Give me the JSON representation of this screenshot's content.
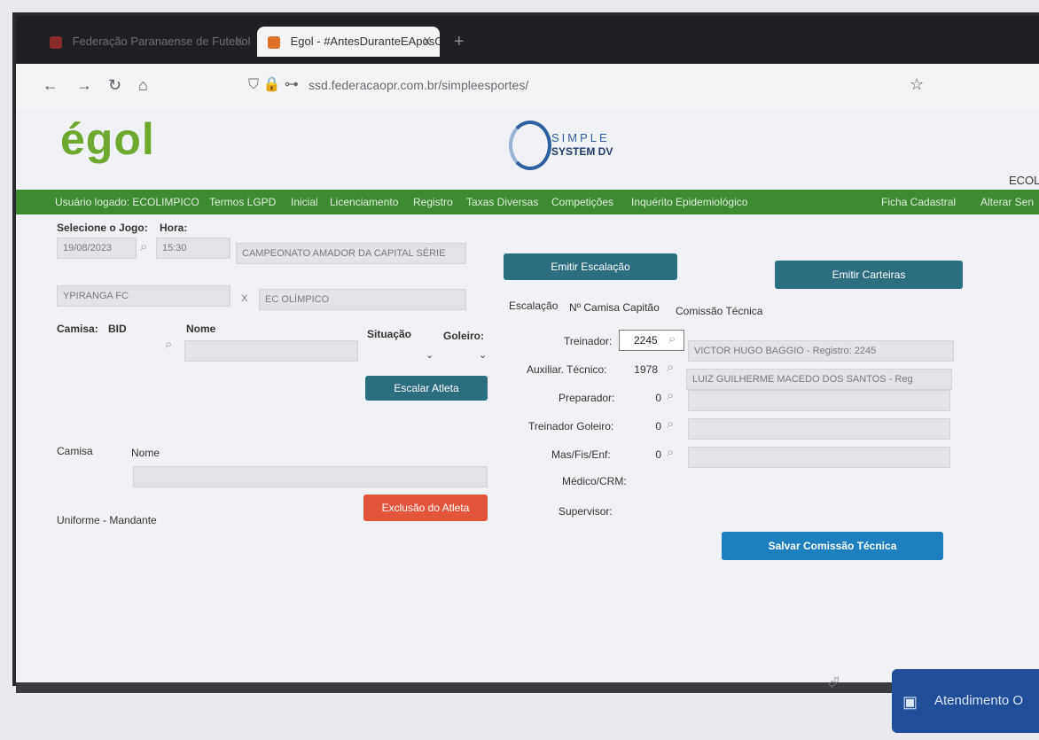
{
  "browser": {
    "tabs": [
      {
        "label": "Federação Paranaense de Futebol",
        "active": false
      },
      {
        "label": "Egol - #AntesDuranteEAposOA",
        "active": true
      }
    ],
    "url": "ssd.federacaopr.com.br/simpleesportes/",
    "new_tab": "+",
    "close": "X"
  },
  "header": {
    "logo": "égol",
    "partner_line1": "SIMPLE",
    "partner_line2": "SYSTEM DV",
    "user_short": "ECOL"
  },
  "nav": {
    "items": [
      "Usuário logado: ECOLIMPICO",
      "Termos LGPD",
      "Inicial",
      "Licenciamento",
      "Registro",
      "Taxas Diversas",
      "Competições",
      "Inquérito Epidemiológico"
    ],
    "right_items": [
      "Ficha Cadastral",
      "Alterar Sen"
    ]
  },
  "form": {
    "select_game_label": "Selecione o Jogo:",
    "hour_label": "Hora:",
    "date_value": "19/08/2023",
    "hour_value": "15:30",
    "competition_value": "CAMPEONATO AMADOR DA CAPITAL SÉRIE",
    "home_team": "YPIRANGA FC",
    "vs": "X",
    "away_team": "EC OLÍMPICO",
    "camisa_label": "Camisa:",
    "bid_label": "BID",
    "nome_label": "Nome",
    "situacao_label": "Situação",
    "goleiro_label": "Goleiro:",
    "camisa2_label": "Camisa",
    "nome2_label": "Nome",
    "uniforme_label": "Uniforme - Mandante"
  },
  "buttons": {
    "emitir_escalacao": "Emitir Escalação",
    "emitir_carteiras": "Emitir Carteiras",
    "escalar_atleta": "Escalar Atleta",
    "exclusao_atleta": "Exclusão do Atleta",
    "salvar_comissao": "Salvar Comissão Técnica"
  },
  "tabs": [
    "Escalação",
    "Nº Camisa Capitão",
    "Comissão Técnica"
  ],
  "staff": [
    {
      "role": "Treinador:",
      "code": "2245",
      "name": "VICTOR HUGO BAGGIO - Registro: 2245"
    },
    {
      "role": "Auxiliar. Técnico:",
      "code": "1978",
      "name": "LUIZ GUILHERME MACEDO DOS SANTOS - Reg"
    },
    {
      "role": "Preparador:",
      "code": "0",
      "name": ""
    },
    {
      "role": "Treinador Goleiro:",
      "code": "0",
      "name": ""
    },
    {
      "role": "Mas/Fis/Enf:",
      "code": "0",
      "name": ""
    },
    {
      "role": "Médico/CRM:",
      "code": "",
      "name": ""
    },
    {
      "role": "Supervisor:",
      "code": "",
      "name": ""
    }
  ],
  "chat": {
    "label": "Atendimento O"
  },
  "colors": {
    "green_nav": "#3c8b31",
    "teal_button": "#2b6f7f",
    "blue_button": "#1e7fbf",
    "red_button": "#e4543a"
  }
}
